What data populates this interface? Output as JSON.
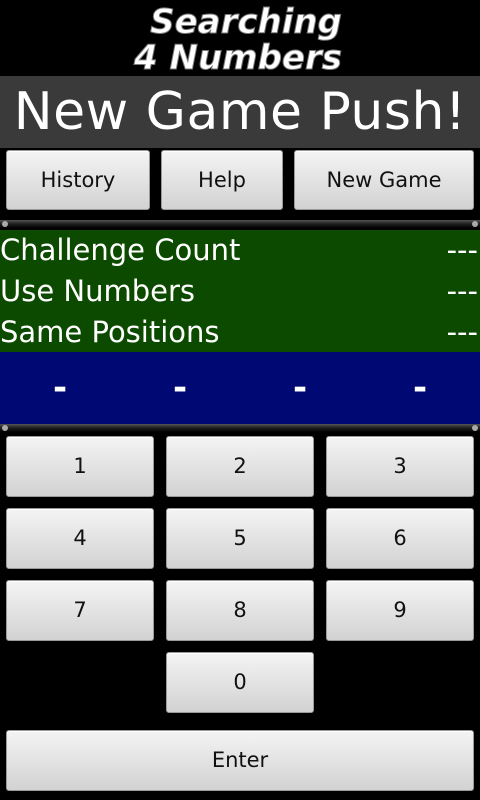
{
  "app": {
    "logo_line1": "Searching",
    "logo_line2": "4 Numbers",
    "status_message": "New Game Push!"
  },
  "top_buttons": {
    "history": "History",
    "help": "Help",
    "new_game": "New Game"
  },
  "info": {
    "challenge_count_label": "Challenge Count",
    "challenge_count_value": "---",
    "use_numbers_label": "Use Numbers",
    "use_numbers_value": "---",
    "same_positions_label": "Same Positions",
    "same_positions_value": "---"
  },
  "guess_digits": [
    "-",
    "-",
    "-",
    "-"
  ],
  "keypad": {
    "k1": "1",
    "k2": "2",
    "k3": "3",
    "k4": "4",
    "k5": "5",
    "k6": "6",
    "k7": "7",
    "k8": "8",
    "k9": "9",
    "k0": "0",
    "enter": "Enter"
  },
  "colors": {
    "status_bg": "#3a3a3a",
    "info_bg": "#0c4a00",
    "guess_bg": "#000873"
  }
}
